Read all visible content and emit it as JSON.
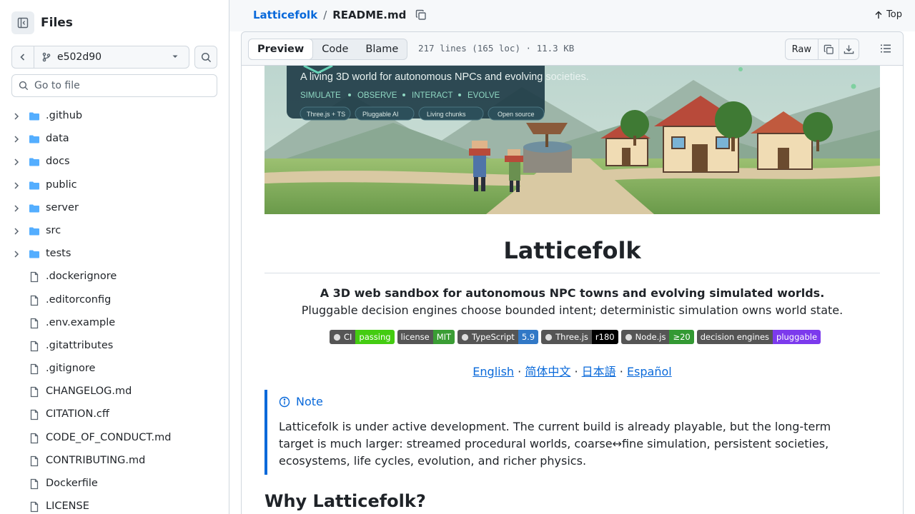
{
  "sidebar": {
    "title": "Files",
    "branch": "e502d90",
    "goto_placeholder": "Go to file",
    "items": [
      {
        "type": "folder",
        "name": ".github"
      },
      {
        "type": "folder",
        "name": "data"
      },
      {
        "type": "folder",
        "name": "docs"
      },
      {
        "type": "folder",
        "name": "public"
      },
      {
        "type": "folder",
        "name": "server"
      },
      {
        "type": "folder",
        "name": "src"
      },
      {
        "type": "folder",
        "name": "tests"
      },
      {
        "type": "file",
        "name": ".dockerignore"
      },
      {
        "type": "file",
        "name": ".editorconfig"
      },
      {
        "type": "file",
        "name": ".env.example"
      },
      {
        "type": "file",
        "name": ".gitattributes"
      },
      {
        "type": "file",
        "name": ".gitignore"
      },
      {
        "type": "file",
        "name": "CHANGELOG.md"
      },
      {
        "type": "file",
        "name": "CITATION.cff"
      },
      {
        "type": "file",
        "name": "CODE_OF_CONDUCT.md"
      },
      {
        "type": "file",
        "name": "CONTRIBUTING.md"
      },
      {
        "type": "file",
        "name": "Dockerfile"
      },
      {
        "type": "file",
        "name": "LICENSE"
      }
    ]
  },
  "header": {
    "repo": "Latticefolk",
    "separator": "/",
    "file": "README.md",
    "top_label": "Top"
  },
  "filebar": {
    "tabs": [
      "Preview",
      "Code",
      "Blame"
    ],
    "active_tab": "Preview",
    "info": "217 lines (165 loc) · 11.3 KB",
    "raw_label": "Raw"
  },
  "banner": {
    "caption": "A living 3D world for autonomous NPCs and evolving societies.",
    "keywords": [
      "SIMULATE",
      "OBSERVE",
      "INTERACT",
      "EVOLVE"
    ],
    "chips": [
      "Three.js + TS",
      "Pluggable AI",
      "Living chunks",
      "Open source"
    ]
  },
  "readme": {
    "title": "Latticefolk",
    "tagline": "A 3D web sandbox for autonomous NPC towns and evolving simulated worlds.",
    "subline": "Pluggable decision engines choose bounded intent; deterministic simulation owns world state.",
    "badges": [
      {
        "label": "CI",
        "value": "passing",
        "color": "#4c1"
      },
      {
        "label": "license",
        "value": "MIT",
        "color": "#3a9d34"
      },
      {
        "label": "TypeScript",
        "value": "5.9",
        "color": "#3178c6"
      },
      {
        "label": "Three.js",
        "value": "r180",
        "color": "#000000"
      },
      {
        "label": "Node.js",
        "value": "≥20",
        "color": "#339933"
      },
      {
        "label": "decision engines",
        "value": "pluggable",
        "color": "#7c3aed"
      }
    ],
    "languages": [
      "English",
      "简体中文",
      "日本語",
      "Español"
    ],
    "lang_separator": "·",
    "note_title": "Note",
    "note_body": "Latticefolk is under active development. The current build is already playable, but the long-term target is much larger: streamed procedural worlds, coarse↔fine simulation, persistent societies, ecosystems, life cycles, evolution, and richer physics.",
    "section_heading": "Why Latticefolk?"
  },
  "colors": {
    "accent": "#0969da",
    "border": "#d0d7de",
    "muted": "#59636e"
  }
}
